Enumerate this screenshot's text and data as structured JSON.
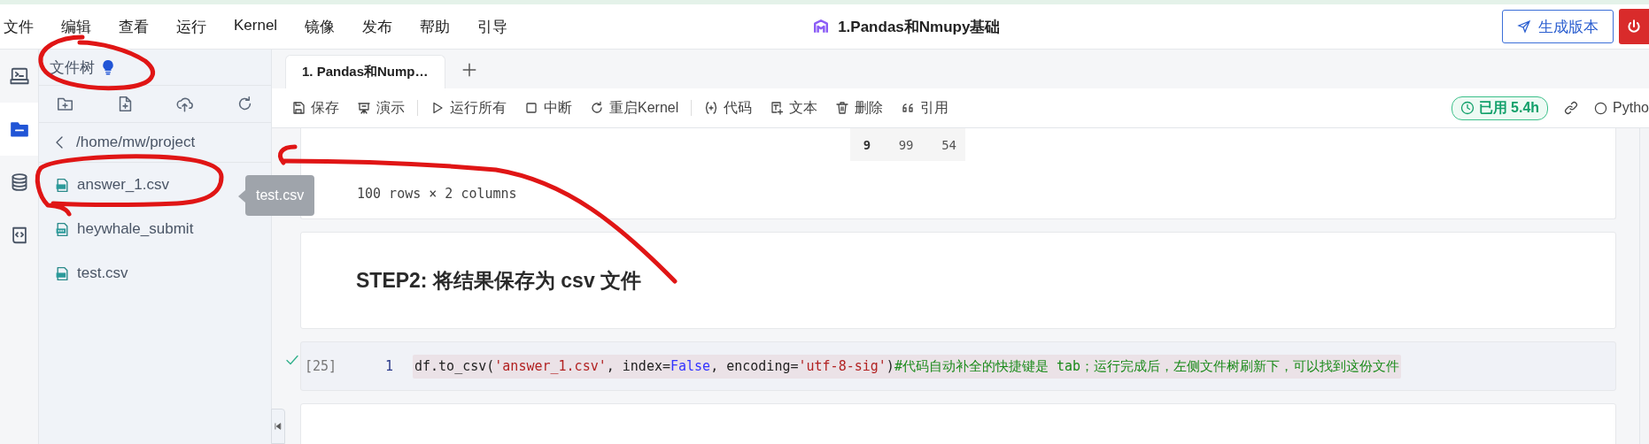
{
  "menu": [
    "文件",
    "编辑",
    "查看",
    "运行",
    "Kernel",
    "镜像",
    "发布",
    "帮助",
    "引导"
  ],
  "title": "1.Pandas和Nmupy基础",
  "publish_button": "生成版本",
  "sidebar": {
    "title": "文件树",
    "path": "/home/mw/project",
    "files": [
      {
        "name": "answer_1.csv",
        "kind": "csv"
      },
      {
        "name": "heywhale_submit",
        "kind": "file"
      },
      {
        "name": "test.csv",
        "kind": "csv"
      }
    ]
  },
  "tabs": [
    {
      "label": "1. Pandas和Nump…",
      "selected": true
    }
  ],
  "toolbar": [
    [
      {
        "label": "保存",
        "kind": "save"
      },
      {
        "label": "演示",
        "kind": "present"
      }
    ],
    [
      {
        "label": "运行所有",
        "kind": "run"
      },
      {
        "label": "中断",
        "kind": "stop"
      },
      {
        "label": "重启Kernel",
        "kind": "restart"
      }
    ],
    [
      {
        "label": "代码",
        "kind": "code"
      },
      {
        "label": "文本",
        "kind": "text"
      },
      {
        "label": "删除",
        "kind": "delete"
      },
      {
        "label": "引用",
        "kind": "cite"
      }
    ]
  ],
  "usage": "已用 5.4h",
  "kernel": "Pytho",
  "cells": [
    {
      "kind": "output",
      "row": [
        "9",
        "99",
        "54"
      ],
      "caption": "100 rows × 2 columns"
    },
    {
      "kind": "markdown",
      "heading": "STEP2: 将结果保存为 csv 文件"
    },
    {
      "kind": "code",
      "executed": true,
      "prompt": "[25]",
      "line": "1",
      "tokens": [
        {
          "kind": "plain",
          "text": "df.to_csv("
        },
        {
          "kind": "string",
          "text": "'answer_1.csv'"
        },
        {
          "kind": "plain",
          "text": ", index="
        },
        {
          "kind": "keyword",
          "text": "False"
        },
        {
          "kind": "plain",
          "text": ", encoding="
        },
        {
          "kind": "string",
          "text": "'utf-8-sig'"
        },
        {
          "kind": "plain",
          "text": ")"
        },
        {
          "kind": "comment",
          "text": "#代码自动补全的快捷键是 tab；运行完成后，左侧文件树刷新下，可以找到这份文件"
        }
      ]
    },
    {
      "kind": "markdown"
    }
  ],
  "tooltip": "test.csv"
}
